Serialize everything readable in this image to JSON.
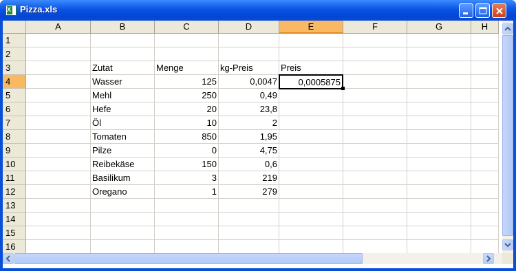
{
  "window": {
    "title": "Pizza.xls",
    "app_icon": "excel-icon"
  },
  "columns": [
    "A",
    "B",
    "C",
    "D",
    "E",
    "F",
    "G",
    "H"
  ],
  "selected_column": "E",
  "rows": [
    "1",
    "2",
    "3",
    "4",
    "5",
    "6",
    "7",
    "8",
    "9",
    "10",
    "11",
    "12",
    "13",
    "14",
    "15",
    "16"
  ],
  "selected_row": "4",
  "cells": {
    "B3": "Zutat",
    "C3": "Menge",
    "D3": "kg-Preis",
    "E3": "Preis",
    "B4": "Wasser",
    "C4": "125",
    "D4": "0,0047",
    "E4": "0,0005875",
    "B5": "Mehl",
    "C5": "250",
    "D5": "0,49",
    "B6": "Hefe",
    "C6": "20",
    "D6": "23,8",
    "B7": "Öl",
    "C7": "10",
    "D7": "2",
    "B8": "Tomaten",
    "C8": "850",
    "D8": "1,95",
    "B9": "Pilze",
    "C9": "0",
    "D9": "4,75",
    "B10": "Reibekäse",
    "C10": "150",
    "D10": "0,6",
    "B11": "Basilikum",
    "C11": "3",
    "D11": "219",
    "B12": "Oregano",
    "C12": "1",
    "D12": "279"
  },
  "active_cell": "E4",
  "colors": {
    "titlebar": "#0a54e3",
    "selected_header": "#f9b862",
    "header_bg": "#ece9d8"
  }
}
